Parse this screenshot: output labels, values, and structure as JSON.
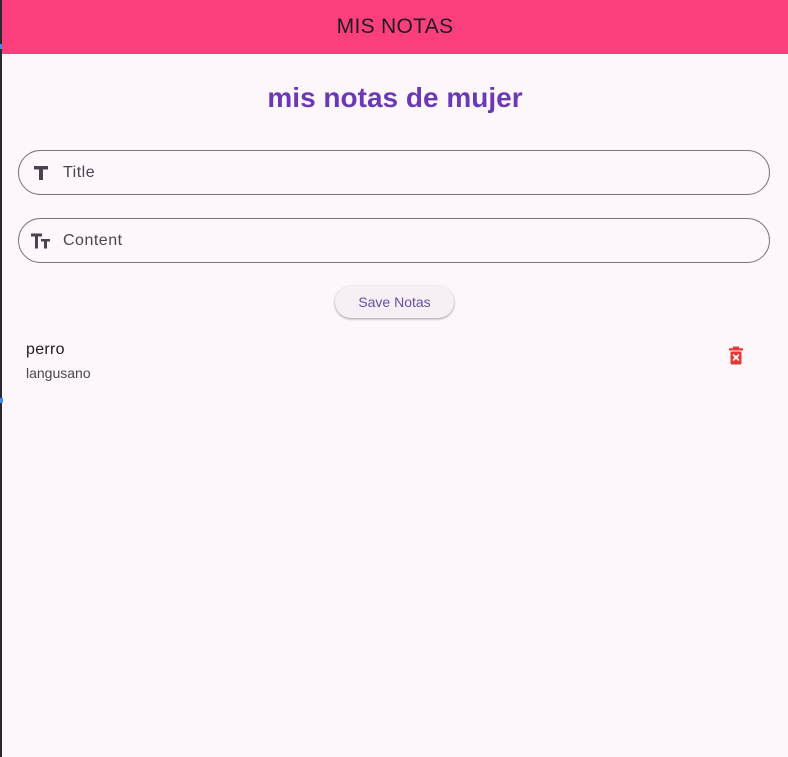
{
  "appbar": {
    "title": "MIS NOTAS",
    "color": "#fb3f7d"
  },
  "heading": {
    "text": "mis notas de mujer",
    "color": "#6a3ab5"
  },
  "form": {
    "title_placeholder": "Title",
    "title_value": "",
    "title_icon": "title-icon",
    "content_placeholder": "Content",
    "content_value": "",
    "content_icon": "text-fields-icon",
    "save_label": "Save Notas"
  },
  "notes": [
    {
      "title": "perro",
      "content": "langusano",
      "delete_icon": "delete-forever-icon",
      "delete_color": "#e53935"
    }
  ]
}
